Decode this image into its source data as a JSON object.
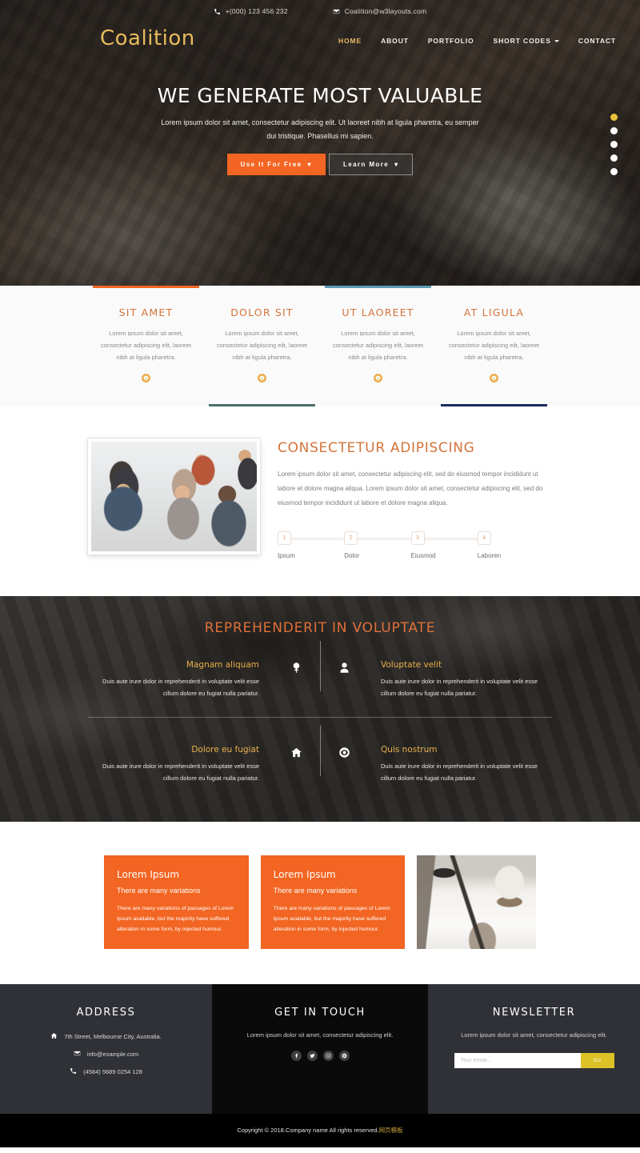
{
  "topbar": {
    "phone": "+(000) 123 456 232",
    "email": "Coalition@w3layouts.com",
    "phone_icon": "phone-icon",
    "email_icon": "envelope-icon"
  },
  "brand": "Coalition",
  "nav": {
    "items": [
      {
        "label": "HOME",
        "active": true
      },
      {
        "label": "ABOUT",
        "active": false
      },
      {
        "label": "PORTFOLIO",
        "active": false
      },
      {
        "label": "SHORT CODES",
        "active": false,
        "caret": true
      },
      {
        "label": "CONTACT",
        "active": false
      }
    ]
  },
  "hero": {
    "title": "WE GENERATE MOST VALUABLE",
    "subtitle": "Lorem ipsum dolor sit amet, consectetur adipiscing elit. Ut laoreet nibh at ligula pharetra, eu semper dui tristique. Phasellus mi sapien.",
    "primary_button": "Use It For Free",
    "secondary_button": "Learn More",
    "chevron": "⌄",
    "slider_dots": 5,
    "active_dot": 0,
    "accent_color": "#f26522",
    "dot_active_color": "#e8c23c"
  },
  "services": {
    "items": [
      {
        "title": "SIT AMET",
        "body": "Lorem ipsum dolor sit amet, consectetur adipiscing elit, laoreet nibh at ligula pharetra.",
        "icon": "smiley-icon",
        "top_line_color": "#f26522",
        "bottom_line_color": "none"
      },
      {
        "title": "DOLOR SIT",
        "body": "Lorem ipsum dolor sit amet, consectetur adipiscing elit, laoreet nibh at ligula pharetra.",
        "icon": "smiley-icon",
        "top_line_color": "none",
        "bottom_line_color": "#4c6f6b"
      },
      {
        "title": "UT LAOREET",
        "body": "Lorem ipsum dolor sit amet, consectetur adipiscing elit, laoreet nibh at ligula pharetra.",
        "icon": "smiley-icon",
        "top_line_color": "#5b9bb5",
        "bottom_line_color": "none"
      },
      {
        "title": "AT LIGULA",
        "body": "Lorem ipsum dolor sit amet, consectetur adipiscing elit, laoreet nibh at ligula pharetra.",
        "icon": "smiley-icon",
        "top_line_color": "none",
        "bottom_line_color": "#1d2b5c"
      }
    ]
  },
  "about": {
    "title": "CONSECTETUR ADIPISCING",
    "body": "Lorem ipsum dolor sit amet, consectetur adipiscing elit, sed do eiusmod tempor incididunt ut labore et dolore magna aliqua. Lorem ipsum dolor sit amet, consectetur adipiscing elit, sed do eiusmod tempor incididunt ut labore et dolore magna aliqua.",
    "photo_alt": "office-team-meeting-photo",
    "steps": [
      {
        "number": "1",
        "label": "Ipsum"
      },
      {
        "number": "2",
        "label": "Dolor"
      },
      {
        "number": "3",
        "label": "Eiusmod"
      },
      {
        "number": "4",
        "label": "Laboren"
      }
    ]
  },
  "parallax": {
    "title": "REPREHENDERIT IN VOLUPTATE",
    "features": [
      {
        "title": "Magnam aliquam",
        "body": "Duis aute irure dolor in reprehenderit in voluptate velit esse cillum dolore eu fugiat nulla pariatur.",
        "icon": "tree-icon"
      },
      {
        "title": "Voluptate velit",
        "body": "Duis aute irure dolor in reprehenderit in voluptate velit esse cillum dolore eu fugiat nulla pariatur.",
        "icon": "user-icon"
      },
      {
        "title": "Dolore eu fugiat",
        "body": "Duis aute irure dolor in reprehenderit in voluptate velit esse cillum dolore eu fugiat nulla pariatur.",
        "icon": "home-icon"
      },
      {
        "title": "Quis nostrum",
        "body": "Duis aute irure dolor in reprehenderit in voluptate velit esse cillum dolore eu fugiat nulla pariatur.",
        "icon": "eye-icon"
      }
    ]
  },
  "cards": {
    "items": [
      {
        "title": "Lorem Ipsum",
        "subtitle": "There are many variations",
        "body": "There are many variations of passages of Lorem Ipsum available, but the majority have suffered alteration in some form, by injected humour."
      },
      {
        "title": "Lorem Ipsum",
        "subtitle": "There are many variations",
        "body": "There are many variations of passages of Lorem Ipsum available, but the majority have suffered alteration in some form, by injected humour."
      }
    ],
    "photo_alt": "hand-writing-with-coffee-photo",
    "background_color": "#f26522"
  },
  "footer": {
    "address": {
      "heading": "ADDRESS",
      "street": "7th Street, Melbourne City, Australia.",
      "email": "info@example.com",
      "phone": "(4584) 5689 0254 128",
      "street_icon": "home-icon",
      "email_icon": "envelope-icon",
      "phone_icon": "phone-icon"
    },
    "touch": {
      "heading": "GET IN TOUCH",
      "text": "Lorem ipsum dolor sit amet, consectetur adipiscing elit.",
      "socials": [
        "facebook-icon",
        "twitter-icon",
        "instagram-icon",
        "pinterest-icon"
      ]
    },
    "newsletter": {
      "heading": "NEWSLETTER",
      "text": "Lorem ipsum dolor sit amet, consectetur adipiscing elit.",
      "placeholder": "Your email...",
      "input_value": "",
      "submit_label": "Go",
      "submit_color": "#dcc127"
    },
    "copyright_prefix": "Copyright © 2018.Company name All rights reserved.",
    "copyright_cn": "网页模板"
  }
}
